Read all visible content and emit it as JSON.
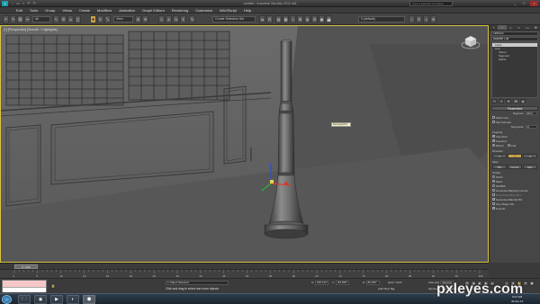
{
  "window": {
    "title": "Untitled   -   Autodesk 3ds Max 2012 x64",
    "search_placeholder": "Type a keyword or phrase",
    "buttons": [
      "_",
      "□",
      "×"
    ]
  },
  "menu": [
    "Edit",
    "Tools",
    "Group",
    "Views",
    "Create",
    "Modifiers",
    "Animation",
    "Graph Editors",
    "Rendering",
    "Customize",
    "MAXScript",
    "Help"
  ],
  "toolbar": {
    "filter": "All",
    "reference": "View",
    "selection_set": "Create Selection Set",
    "layer": "0 (default)"
  },
  "viewport": {
    "label": "[+] [Perspective] [Smooth + Highlights]",
    "tooltip": "Rectangle001"
  },
  "command_panel": {
    "tabs": [
      "+",
      "⌐",
      "⛬",
      "◐",
      "▭",
      "⚒"
    ],
    "object_name": "Line016",
    "modifier_list": "Modifier List",
    "stack": [
      {
        "label": "Lathe",
        "selected": true,
        "sub": false
      },
      {
        "label": "Line",
        "selected": false,
        "sub": false
      },
      {
        "label": "Vertex",
        "selected": false,
        "sub": true
      },
      {
        "label": "Segment",
        "selected": false,
        "sub": true
      },
      {
        "label": "Spline",
        "selected": false,
        "sub": true
      }
    ],
    "rollout_title": "Parameters",
    "degrees_label": "Degrees:",
    "degrees_value": "360.0",
    "weld_core": "Weld Core",
    "flip_normals": "Flip Normals",
    "segments_label": "Segments:",
    "segments_value": "16",
    "capping_label": "Capping",
    "cap_start": "Cap Start",
    "cap_end": "Cap End",
    "morph": "Morph",
    "grid": "Grid",
    "direction_label": "Direction",
    "direction_buttons": [
      "X",
      "Y",
      "Z"
    ],
    "align_label": "Align",
    "align_buttons": [
      "Min",
      "Center",
      "Max"
    ],
    "output_label": "Output",
    "output_options": [
      "Patch",
      "Mesh",
      "NURBS"
    ],
    "gen_mapping": "Generate Mapping Coords.",
    "real_world": "Real-World Map Size",
    "gen_material_ids": "Generate Material IDs",
    "use_shape_ids": "Use Shape IDs",
    "smooth": "Smooth"
  },
  "timeline": {
    "frame": "0 / 100",
    "ticks": [
      "0",
      "5",
      "10",
      "15",
      "20",
      "25",
      "30",
      "35",
      "40",
      "45",
      "50",
      "55",
      "60",
      "65",
      "70",
      "75",
      "80",
      "85",
      "90",
      "95",
      "100"
    ]
  },
  "status": {
    "selection": "1 Object Selected",
    "prompt": "Click and drag to select and move objects",
    "x_label": "X:",
    "x_value": "168.142\"",
    "y_label": "Y:",
    "y_value": "-83.608\"",
    "z_label": "Z:",
    "z_value": "82.295\"",
    "grid": "Grid = 10.0\"",
    "auto_key": "Auto Key",
    "auto_key_value": "Selected",
    "set_key": "Set Key",
    "key_filters": "Key Filters...",
    "add_time_tag": "Add Time Tag"
  },
  "taskbar": {
    "time": "9:17 AM",
    "date": "30-Apr-12",
    "apps": [
      "🗁",
      "◉",
      "▶",
      "◐",
      "⬢"
    ]
  },
  "watermark": "pxleyes.com"
}
